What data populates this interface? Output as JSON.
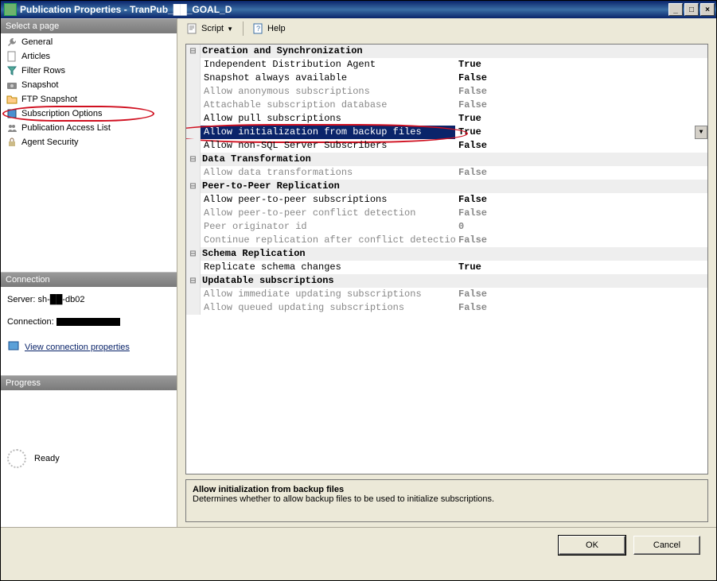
{
  "window": {
    "title": "Publication Properties - TranPub_██_GOAL_D"
  },
  "sidebar": {
    "select_page_hdr": "Select a page",
    "items": [
      {
        "label": "General",
        "icon": "wrench"
      },
      {
        "label": "Articles",
        "icon": "page"
      },
      {
        "label": "Filter Rows",
        "icon": "filter"
      },
      {
        "label": "Snapshot",
        "icon": "camera"
      },
      {
        "label": "FTP Snapshot",
        "icon": "folder"
      },
      {
        "label": "Subscription Options",
        "icon": "book",
        "selected": true
      },
      {
        "label": "Publication Access List",
        "icon": "users"
      },
      {
        "label": "Agent Security",
        "icon": "lock"
      }
    ],
    "connection_hdr": "Connection",
    "server_label": "Server:",
    "server_value": "sh-██-db02",
    "connection_label": "Connection:",
    "connection_value": "████████████",
    "view_conn_props": "View connection properties",
    "progress_hdr": "Progress",
    "progress_status": "Ready"
  },
  "toolbar": {
    "script_label": "Script",
    "help_label": "Help"
  },
  "grid": {
    "categories": [
      {
        "name": "Creation and Synchronization",
        "rows": [
          {
            "label": "Independent Distribution Agent",
            "value": "True",
            "disabled": false
          },
          {
            "label": "Snapshot always available",
            "value": "False",
            "disabled": false
          },
          {
            "label": "Allow anonymous subscriptions",
            "value": "False",
            "disabled": true
          },
          {
            "label": "Attachable subscription database",
            "value": "False",
            "disabled": true
          },
          {
            "label": "Allow pull subscriptions",
            "value": "True",
            "disabled": false
          },
          {
            "label": "Allow initialization from backup files",
            "value": "True",
            "selected": true,
            "circled": true,
            "dropdown": true
          },
          {
            "label": "Allow non-SQL Server Subscribers",
            "value": "False",
            "disabled": false
          }
        ]
      },
      {
        "name": "Data Transformation",
        "rows": [
          {
            "label": "Allow data transformations",
            "value": "False",
            "disabled": true
          }
        ]
      },
      {
        "name": "Peer-to-Peer Replication",
        "rows": [
          {
            "label": "Allow peer-to-peer subscriptions",
            "value": "False",
            "disabled": false
          },
          {
            "label": "Allow peer-to-peer conflict detection",
            "value": "False",
            "disabled": true
          },
          {
            "label": "Peer originator id",
            "value": "0",
            "disabled": true
          },
          {
            "label": "Continue replication after conflict detection",
            "value": "False",
            "disabled": true
          }
        ]
      },
      {
        "name": "Schema Replication",
        "rows": [
          {
            "label": "Replicate schema changes",
            "value": "True",
            "disabled": false
          }
        ]
      },
      {
        "name": "Updatable subscriptions",
        "rows": [
          {
            "label": "Allow immediate updating subscriptions",
            "value": "False",
            "disabled": true
          },
          {
            "label": "Allow queued updating subscriptions",
            "value": "False",
            "disabled": true
          }
        ]
      }
    ]
  },
  "description": {
    "title": "Allow initialization from backup files",
    "text": "Determines whether to allow backup files to be used to initialize subscriptions."
  },
  "buttons": {
    "ok": "OK",
    "cancel": "Cancel"
  }
}
